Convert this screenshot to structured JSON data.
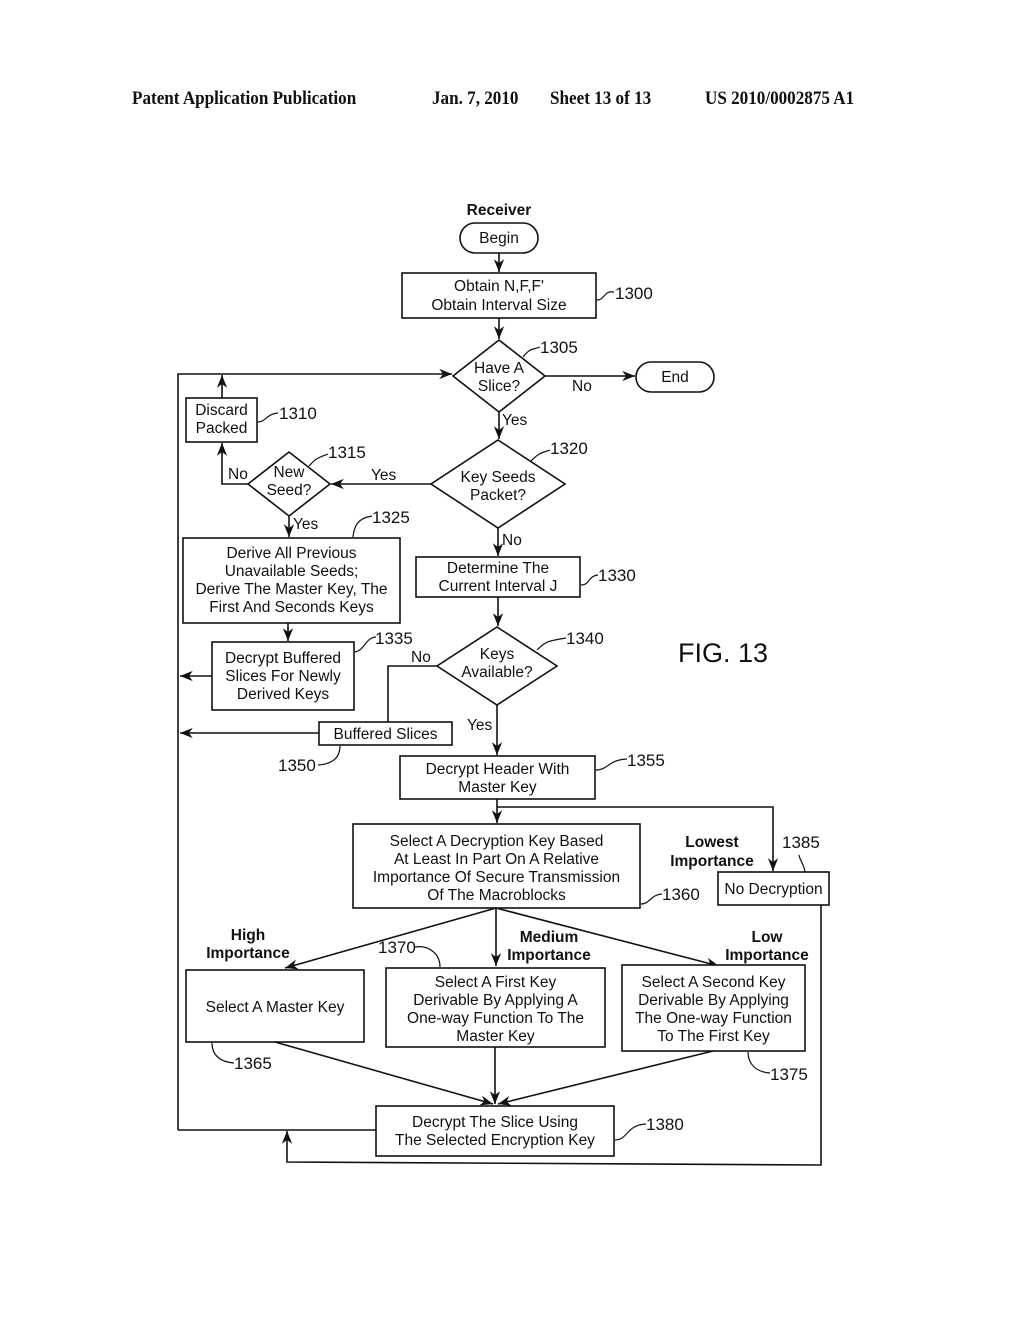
{
  "header": {
    "publication": "Patent Application Publication",
    "date": "Jan. 7, 2010",
    "sheet": "Sheet 13 of 13",
    "patent_number": "US 2010/0002875 A1"
  },
  "figure": {
    "label": "FIG. 13",
    "title": "Receiver"
  },
  "nodes": {
    "begin": {
      "text": "Begin"
    },
    "end": {
      "text": "End"
    },
    "n1300": {
      "ref": "1300",
      "lines": [
        "Obtain N,F,F'",
        "Obtain Interval Size"
      ]
    },
    "n1305": {
      "ref": "1305",
      "lines": [
        "Have A",
        "Slice?"
      ]
    },
    "n1310": {
      "ref": "1310",
      "lines": [
        "Discard",
        "Packed"
      ]
    },
    "n1315": {
      "ref": "1315",
      "lines": [
        "New",
        "Seed?"
      ]
    },
    "n1320": {
      "ref": "1320",
      "lines": [
        "Key Seeds",
        "Packet?"
      ]
    },
    "n1325": {
      "ref": "1325",
      "lines": [
        "Derive All Previous",
        "Unavailable Seeds;",
        "Derive The Master Key, The",
        "First And Seconds Keys"
      ]
    },
    "n1330": {
      "ref": "1330",
      "lines": [
        "Determine The",
        "Current Interval J"
      ]
    },
    "n1335": {
      "ref": "1335",
      "lines": [
        "Decrypt Buffered",
        "Slices For Newly",
        "Derived Keys"
      ]
    },
    "n1340": {
      "ref": "1340",
      "lines": [
        "Keys",
        "Available?"
      ]
    },
    "n1350": {
      "ref": "1350",
      "lines": [
        "Buffered Slices"
      ]
    },
    "n1355": {
      "ref": "1355",
      "lines": [
        "Decrypt Header With",
        "Master Key"
      ]
    },
    "n1360": {
      "ref": "1360",
      "lines": [
        "Select A Decryption Key Based",
        "At Least In Part On A Relative",
        "Importance Of Secure Transmission",
        "Of The Macroblocks"
      ]
    },
    "n1365": {
      "ref": "1365",
      "lines": [
        "Select A Master Key"
      ]
    },
    "n1370": {
      "ref": "1370",
      "lines": [
        "Select A First Key",
        "Derivable By Applying A",
        "One-way Function To The",
        "Master Key"
      ]
    },
    "n1375": {
      "ref": "1375",
      "lines": [
        "Select A Second Key",
        "Derivable By Applying",
        "The One-way Function",
        "To The First Key"
      ]
    },
    "n1380": {
      "ref": "1380",
      "lines": [
        "Decrypt The Slice Using",
        "The Selected Encryption Key"
      ]
    },
    "n1385": {
      "ref": "1385",
      "lines": [
        "No Decryption"
      ]
    }
  },
  "edge_labels": {
    "slice_no": "No",
    "slice_yes": "Yes",
    "keyseeds_yes": "Yes",
    "keyseeds_no": "No",
    "newseed_no": "No",
    "newseed_yes": "Yes",
    "keys_no": "No",
    "keys_yes": "Yes"
  },
  "importance_labels": {
    "high": [
      "High",
      "Importance"
    ],
    "medium": [
      "Medium",
      "Importance"
    ],
    "low": [
      "Low",
      "Importance"
    ],
    "lowest": [
      "Lowest",
      "Importance"
    ]
  }
}
